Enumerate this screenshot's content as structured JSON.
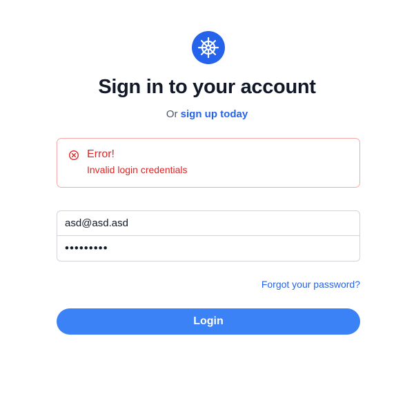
{
  "header": {
    "logo_icon": "ship-wheel-icon",
    "title": "Sign in to your account",
    "subtitle_prefix": "Or",
    "signup_link": "sign up today"
  },
  "alert": {
    "icon": "x-circle-icon",
    "title": "Error!",
    "message": "Invalid login credentials"
  },
  "form": {
    "email_value": "asd@asd.asd",
    "password_value": "•••••••••",
    "forgot_link": "Forgot your password?",
    "login_label": "Login"
  },
  "colors": {
    "brand": "#2563eb",
    "button": "#3b82f6",
    "error": "#dc2626",
    "error_border": "#f8a5a5"
  }
}
